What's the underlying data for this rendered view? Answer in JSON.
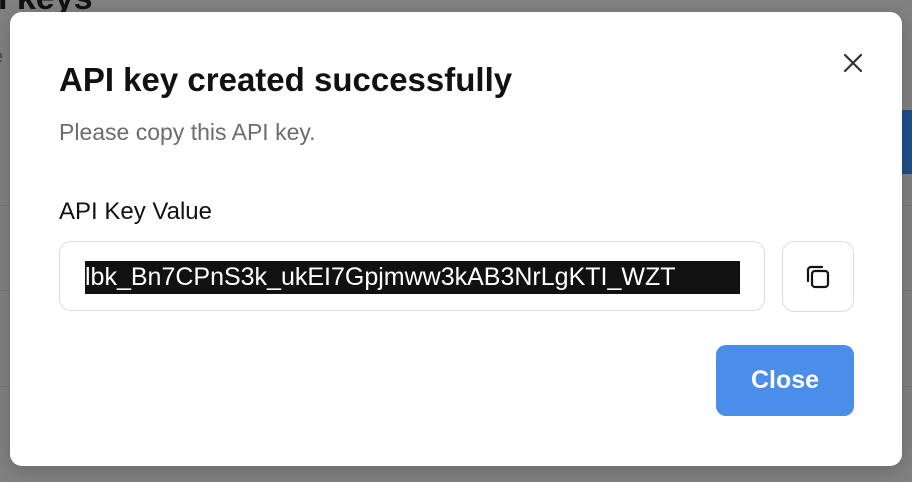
{
  "background": {
    "title": "I keys",
    "subtitle": "e"
  },
  "modal": {
    "title": "API key created successfully",
    "description": "Please copy this API key.",
    "field_label": "API Key Value",
    "key_value": "lbk_Bn7CPnS3k_ukEI7Gpjmww3kAB3NrLgKTI_WZT",
    "close_button_label": "Close",
    "icons": {
      "dismiss": "close-icon",
      "copy": "copy-icon"
    },
    "colors": {
      "primary": "#4a8eea",
      "selection": "#111111"
    }
  }
}
